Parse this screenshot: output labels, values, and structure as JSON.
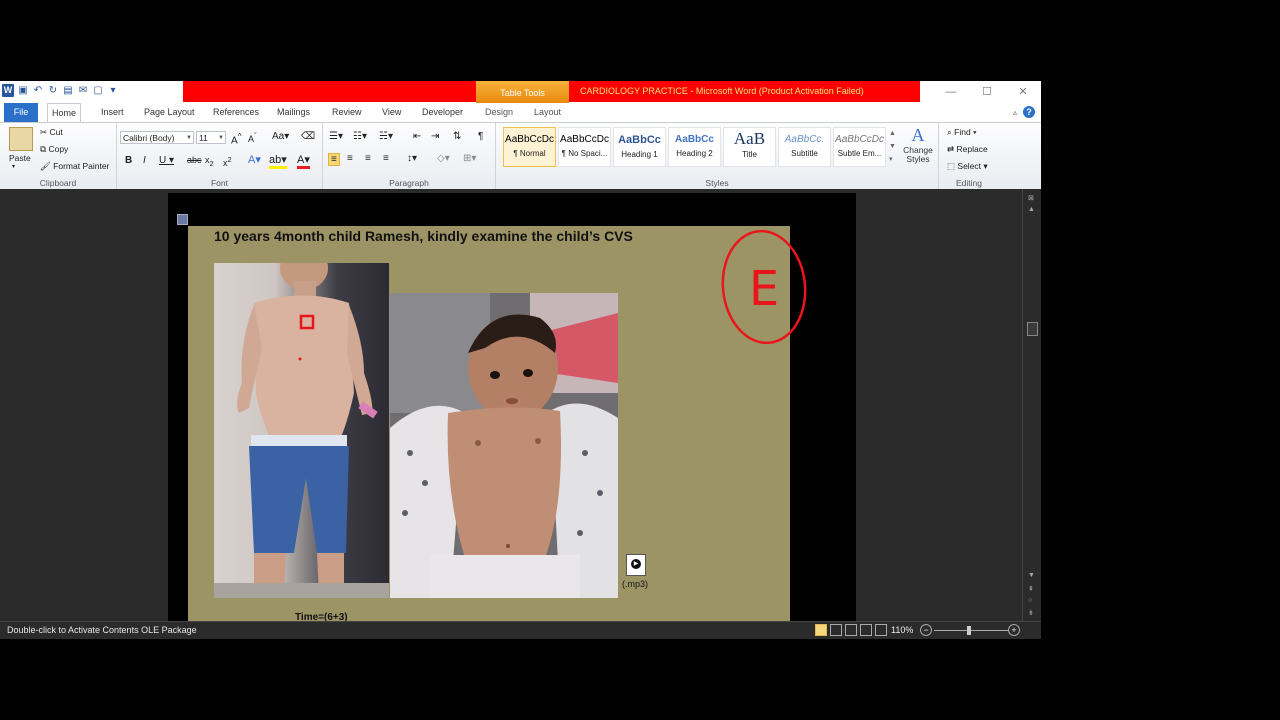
{
  "window": {
    "title": "CARDIOLOGY PRACTICE  -  Microsoft Word (Product Activation Failed)",
    "context_tab": "Table Tools"
  },
  "tabs": [
    "File",
    "Home",
    "Insert",
    "Page Layout",
    "References",
    "Mailings",
    "Review",
    "View",
    "Developer",
    "Design",
    "Layout"
  ],
  "clipboard": {
    "paste": "Paste",
    "cut": "Cut",
    "copy": "Copy",
    "format_painter": "Format Painter",
    "label": "Clipboard"
  },
  "font": {
    "name": "Calibri (Body)",
    "size": "11",
    "label": "Font"
  },
  "paragraph": {
    "label": "Paragraph"
  },
  "styles": {
    "label": "Styles",
    "items": [
      {
        "preview": "AaBbCcDc",
        "name": "¶ Normal"
      },
      {
        "preview": "AaBbCcDc",
        "name": "¶ No Spaci..."
      },
      {
        "preview": "AaBbCc",
        "name": "Heading 1"
      },
      {
        "preview": "AaBbCc",
        "name": "Heading 2"
      },
      {
        "preview": "AaB",
        "name": "Title"
      },
      {
        "preview": "AaBbCc.",
        "name": "Subtitle"
      },
      {
        "preview": "AaBbCcDc",
        "name": "Subtle Em..."
      }
    ],
    "change_styles": "Change Styles"
  },
  "editing": {
    "find": "Find",
    "replace": "Replace",
    "select": "Select",
    "label": "Editing"
  },
  "document": {
    "heading": "10 years 4month child Ramesh, kindly examine the child’s CVS",
    "attachment_label": "(.mp3)",
    "time_text": "Time=(6+3)",
    "annotation_letter": "E",
    "colors": {
      "slide_bg": "#9d9466",
      "annotation": "#e8161b"
    }
  },
  "status": {
    "message": "Double-click to Activate Contents OLE Package",
    "zoom": "110%"
  }
}
